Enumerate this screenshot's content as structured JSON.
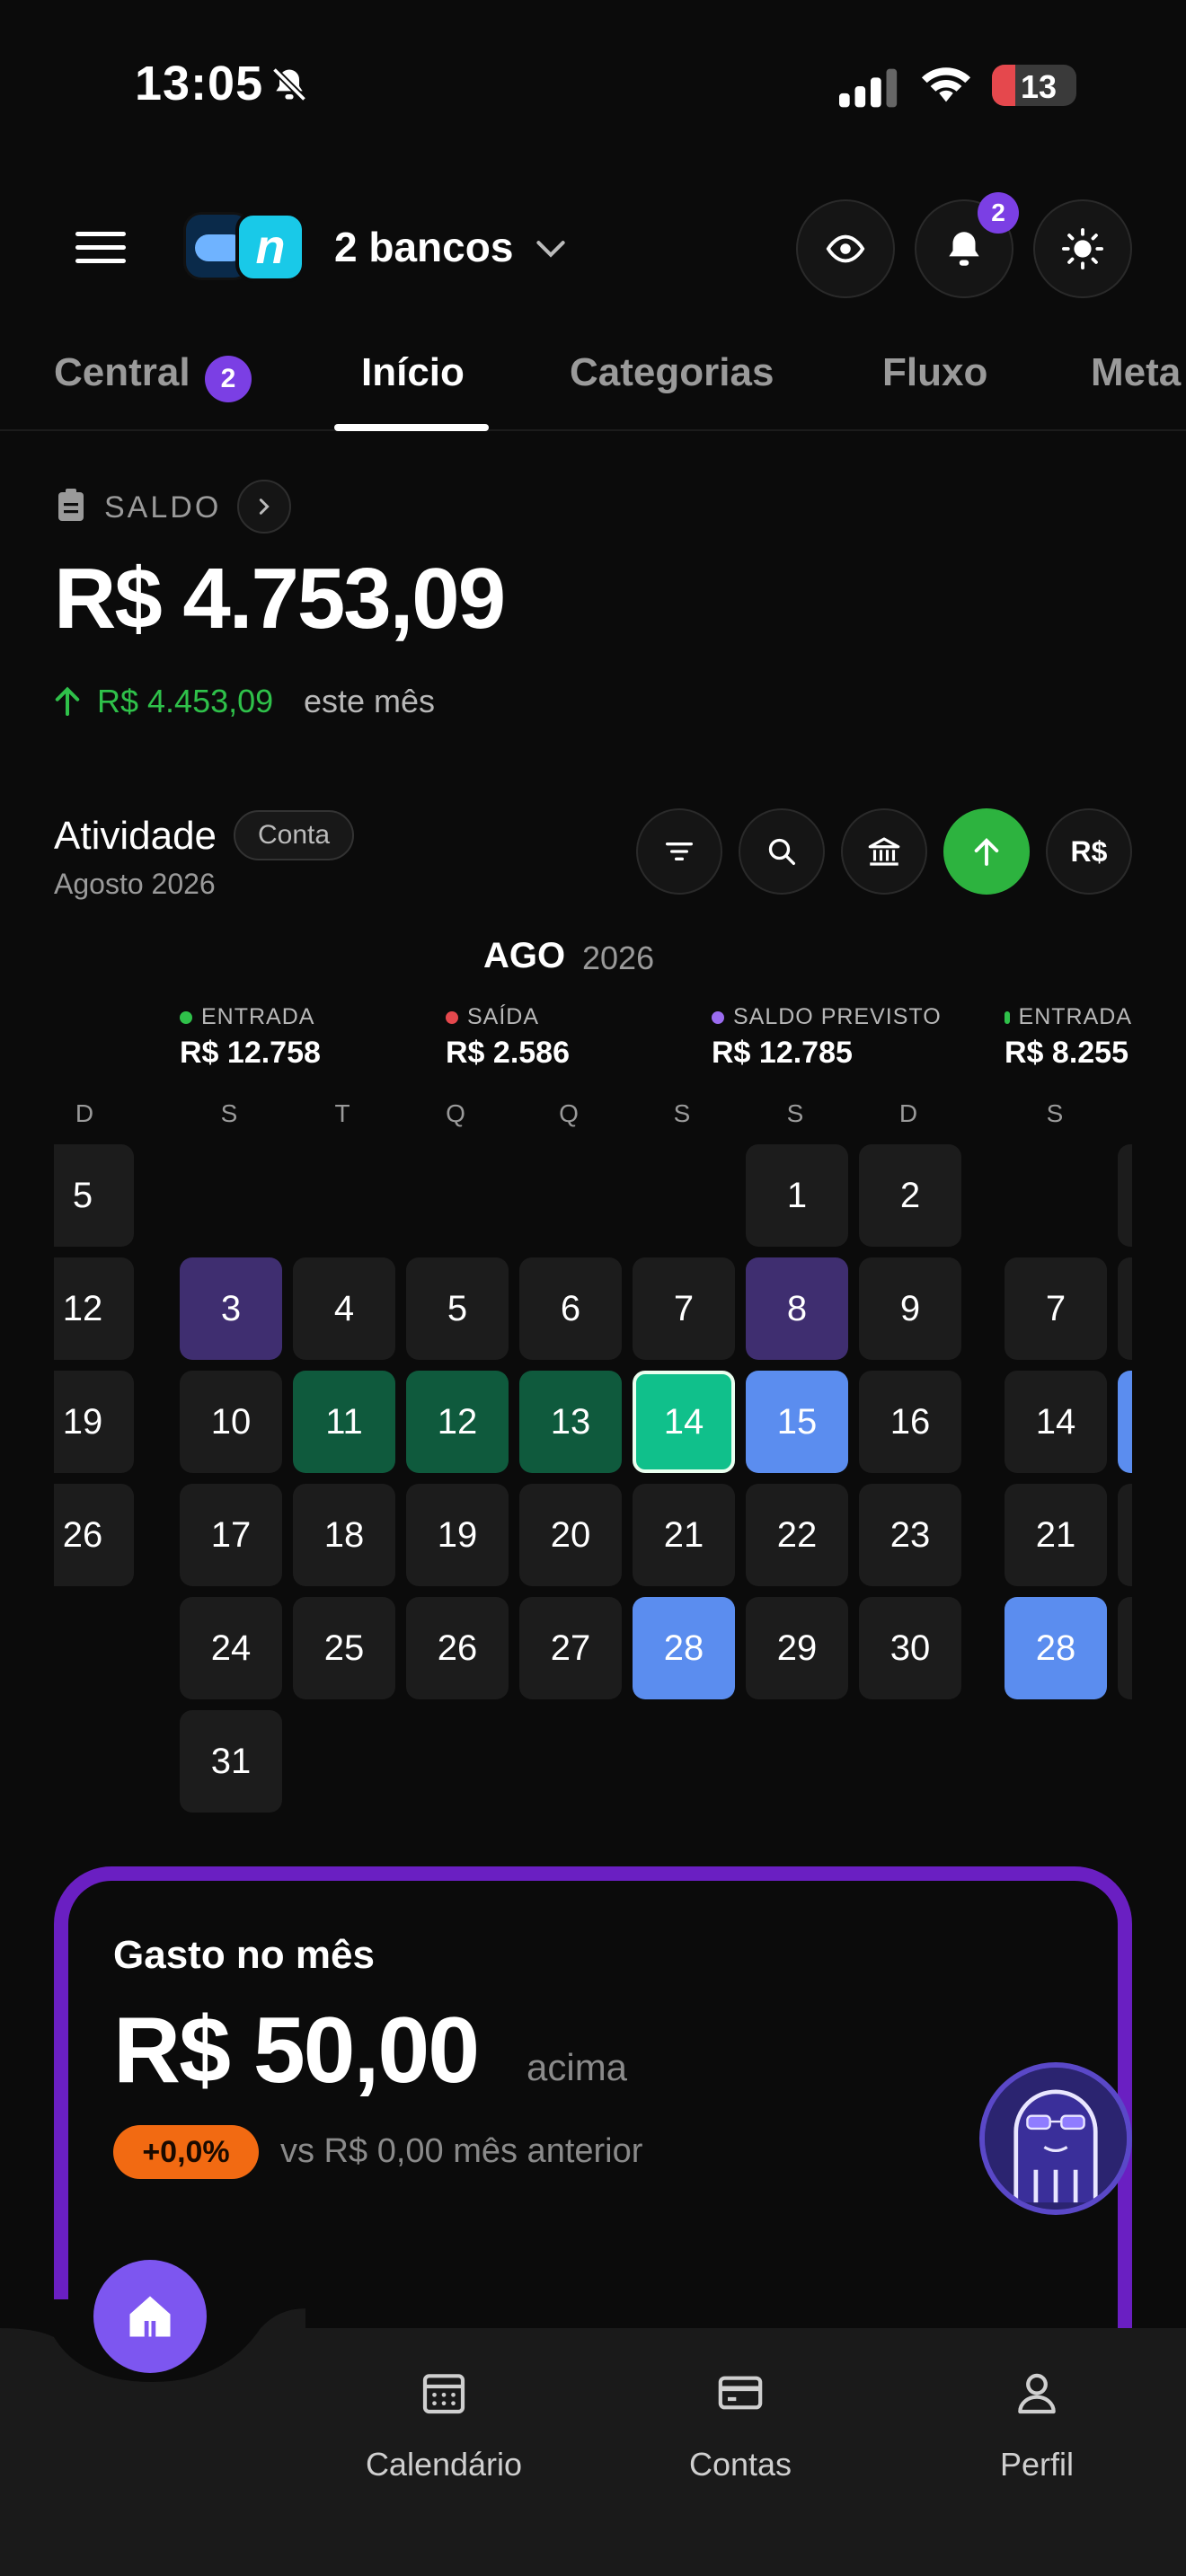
{
  "status_bar": {
    "time": "13:05",
    "battery": "13"
  },
  "header": {
    "bank_selector": "2 bancos",
    "notification_count": "2"
  },
  "tabs": [
    {
      "label": "Central",
      "badge": "2"
    },
    {
      "label": "Início"
    },
    {
      "label": "Categorias"
    },
    {
      "label": "Fluxo"
    },
    {
      "label": "Meta"
    }
  ],
  "balance": {
    "label": "SALDO",
    "value": "R$ 4.753,09",
    "delta": "R$ 4.453,09",
    "delta_suffix": "este mês",
    "delta_color": "#2fc14a"
  },
  "activity": {
    "title": "Atividade",
    "chip": "Conta",
    "period": "Agosto 2026",
    "currency_button": "R$"
  },
  "calendar": {
    "month": "AGO",
    "year": "2026",
    "stats": [
      {
        "label": "ENTRADA",
        "value": "R$ 12.758",
        "color": "#2fc14a"
      },
      {
        "label": "SAÍDA",
        "value": "R$ 2.586",
        "color": "#e5484d"
      },
      {
        "label": "SALDO PREVISTO",
        "value": "R$ 12.785",
        "color": "#9b6cf0"
      },
      {
        "label": "ENTRADA",
        "value": "R$ 8.255",
        "color": "#2fc14a"
      }
    ],
    "weekdays_prev": [
      "D"
    ],
    "weekdays": [
      "S",
      "T",
      "Q",
      "Q",
      "S",
      "S",
      "D"
    ],
    "weekdays_next": [
      "S"
    ],
    "prev_column": [
      "5",
      "12",
      "19",
      "26"
    ],
    "weeks": [
      [
        "",
        "",
        "",
        "",
        "",
        "1",
        "2"
      ],
      [
        "3",
        "4",
        "5",
        "6",
        "7",
        "8",
        "9"
      ],
      [
        "10",
        "11",
        "12",
        "13",
        "14",
        "15",
        "16"
      ],
      [
        "17",
        "18",
        "19",
        "20",
        "21",
        "22",
        "23"
      ],
      [
        "24",
        "25",
        "26",
        "27",
        "28",
        "29",
        "30"
      ],
      [
        "31",
        "",
        "",
        "",
        "",
        "",
        ""
      ]
    ],
    "next_column": [
      "",
      "7",
      "14",
      "21",
      "28"
    ],
    "highlight_colors": {
      "purple": "#3f2e70",
      "green": "#0f5a3d",
      "today": "#10c08b",
      "blue": "#5b8def"
    }
  },
  "spending": {
    "title": "Gasto no mês",
    "value": "R$ 50,00",
    "suffix": "acima",
    "pct": "+0,0%",
    "comparison": "vs R$ 0,00 mês anterior",
    "accent": "#6a1fc2"
  },
  "bottom_nav": [
    {
      "label": "Calendário",
      "icon": "calendar-icon"
    },
    {
      "label": "Contas",
      "icon": "card-icon"
    },
    {
      "label": "Perfil",
      "icon": "user-icon"
    }
  ]
}
